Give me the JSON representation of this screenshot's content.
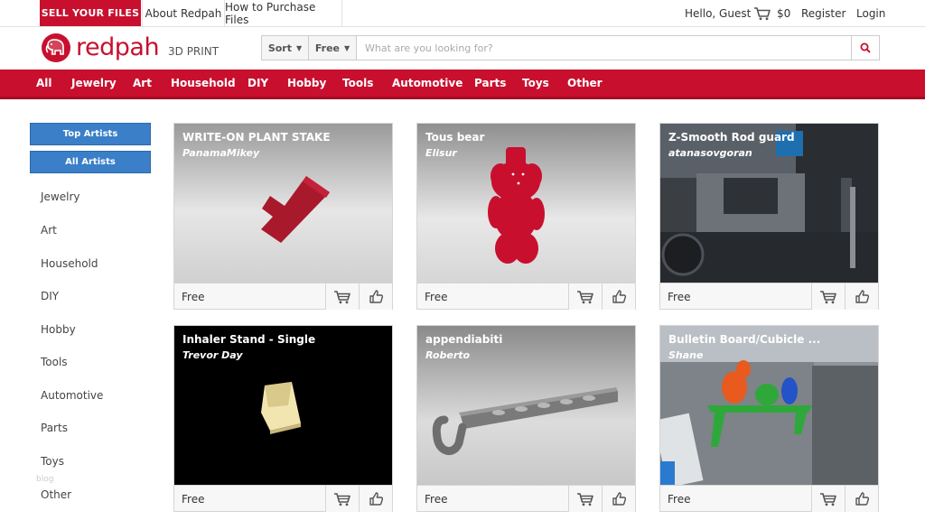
{
  "topbar": {
    "sell_label": "SELL YOUR FILES",
    "about_label": "About Redpah",
    "purchase_label": "How to Purchase Files",
    "greeting": "Hello, Guest",
    "cart_icon": "cart-icon",
    "cart_total": "$0",
    "register_label": "Register",
    "login_label": "Login"
  },
  "header": {
    "brand": "redpah",
    "brand_sub": "3D PRINT",
    "logo_icon": "elephant-logo-icon",
    "brand_color": "#c8102e"
  },
  "search": {
    "sort_label": "Sort",
    "free_label": "Free",
    "placeholder": "What are you looking for?",
    "value": "",
    "search_icon": "search-icon"
  },
  "nav": {
    "items": [
      "All",
      "Jewelry",
      "Art",
      "Household",
      "DIY",
      "Hobby",
      "Tools",
      "Automotive",
      "Parts",
      "Toys",
      "Other"
    ]
  },
  "sidebar": {
    "top_artists": "Top Artists",
    "all_artists": "All Artists",
    "items": [
      "Jewelry",
      "Art",
      "Household",
      "DIY",
      "Hobby",
      "Tools",
      "Automotive",
      "Parts",
      "Toys",
      "Other"
    ],
    "faint_text": "blog",
    "accent": "#3a7fc8"
  },
  "cards": [
    {
      "title": "WRITE-ON PLANT STAKE",
      "author": "PanamaMikey",
      "price": "Free"
    },
    {
      "title": "Tous bear",
      "author": "Elisur",
      "price": "Free"
    },
    {
      "title": "Z-Smooth Rod guard",
      "author": "atanasovgoran",
      "price": "Free"
    },
    {
      "title": "Inhaler Stand - Single",
      "author": "Trevor Day",
      "price": "Free"
    },
    {
      "title": "appendiabiti",
      "author": "Roberto",
      "price": "Free"
    },
    {
      "title": "Bulletin Board/Cubicle ...",
      "author": "Shane",
      "price": "Free"
    }
  ]
}
